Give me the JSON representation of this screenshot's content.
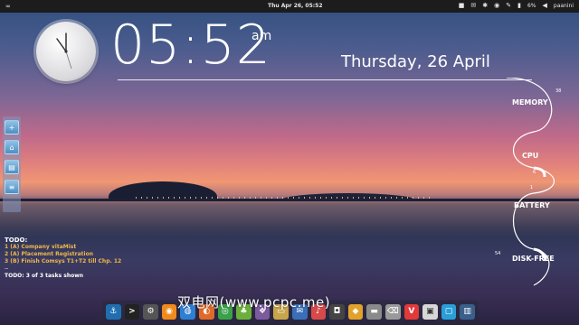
{
  "panel": {
    "logo_icon": "ubuntu-logo-icon",
    "clock": "Thu Apr 26, 05:52",
    "battery": "6%",
    "user": "paanini"
  },
  "clock_widget": {
    "time": "05:52",
    "ampm": "am",
    "date": "Thursday, 26 April"
  },
  "monitors": [
    {
      "label": "MEMORY",
      "value": "38"
    },
    {
      "label": "CPU",
      "value": "6"
    },
    {
      "label": "BATTERY",
      "value": "1"
    },
    {
      "label": "DISK-FREE",
      "value": "54"
    }
  ],
  "todo": {
    "title": "TODO:",
    "items": [
      "1 (A) Company vitaMist",
      "2 (A) Placement Registration",
      "3 (B) Finish Comsys T1+T2 till Chp. 12"
    ],
    "separator": "--",
    "footer": "TODO: 3 of 3 tasks shown"
  },
  "left_dock_icons": [
    "app-icon-1",
    "app-icon-2",
    "app-icon-3",
    "app-icon-4"
  ],
  "bottom_dock_icons": [
    "anchor-icon",
    "terminal-icon",
    "settings-icon",
    "rss-icon",
    "globe-icon",
    "firefox-icon",
    "chrome-icon",
    "game-icon",
    "files-icon",
    "folder-icon",
    "mail-icon",
    "music-icon",
    "camera-icon",
    "bag-icon",
    "drive-icon",
    "trash-icon",
    "vivaldi-icon",
    "photo-icon",
    "window-icon",
    "monitor-icon"
  ],
  "watermark": "双电网(www.pcpc.me)"
}
